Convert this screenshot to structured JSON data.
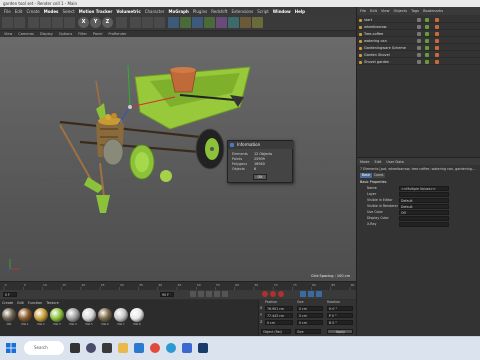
{
  "window": {
    "title": "garden tool set - Render cell 1 - Main"
  },
  "menu": {
    "items": [
      "File",
      "Edit",
      "Create",
      "Modes",
      "Select",
      "Motion Tracker",
      "Volumetric",
      "Character",
      "MoGraph",
      "Plugins",
      "Redshift",
      "Extensions",
      "Script",
      "Window",
      "Help"
    ]
  },
  "toolbar": {
    "x": "X",
    "y": "Y",
    "z": "Z"
  },
  "viewport": {
    "menu": [
      "View",
      "Cameras",
      "Display",
      "Options",
      "Filter",
      "Panel",
      "ProRender"
    ],
    "grid_spacing": "Grid Spacing : 100 cm"
  },
  "dialog": {
    "title": "Information",
    "rows": [
      {
        "label": "Elements",
        "value": "12 Objects"
      },
      {
        "label": "Points",
        "value": "25909"
      },
      {
        "label": "Polygons",
        "value": "16940"
      },
      {
        "label": "Objects",
        "value": "6"
      }
    ],
    "ok_label": "OK"
  },
  "object_manager": {
    "menu": [
      "File",
      "Edit",
      "View",
      "Objects",
      "Tags",
      "Bookmarks"
    ],
    "objects": [
      "start",
      "wheelbarrow",
      "Tree-coffee",
      "watering can",
      "Gardeningware Scheme",
      "Garden Shovel",
      "Shovel garden"
    ]
  },
  "attributes": {
    "menu": [
      "Mode",
      "Edit",
      "User Data"
    ],
    "header": "7 Elements [pot, wheelbarrow, tree coffee, watering can, gardening...",
    "tabs": [
      "Basic",
      "Coord."
    ],
    "section": "Basic Properties",
    "rows": [
      {
        "label": "Name",
        "value": "<<Multiple Values>>"
      },
      {
        "label": "Layer",
        "value": ""
      },
      {
        "label": "Visible in Editor",
        "value": "Default"
      },
      {
        "label": "Visible in Renderer",
        "value": "Default"
      },
      {
        "label": "Use Color",
        "value": "Off"
      },
      {
        "label": "Display Color",
        "value": ""
      },
      {
        "label": "X-Ray",
        "value": ""
      }
    ]
  },
  "timeline": {
    "frame_current": "0 F",
    "frame_end": "90 F",
    "ticks": [
      "0",
      "5",
      "10",
      "15",
      "20",
      "25",
      "30",
      "35",
      "40",
      "45",
      "50",
      "55",
      "60",
      "65",
      "70",
      "75",
      "80",
      "85",
      "90"
    ]
  },
  "materials": {
    "menu": [
      "Create",
      "Edit",
      "Function",
      "Texture"
    ],
    "items": [
      "Mat",
      "Mat.1",
      "Mat.2",
      "Mat.3",
      "Mat.4",
      "Mat.5",
      "Mat.6",
      "Mat.7",
      "Mat.8"
    ],
    "colors": [
      "#6d6250",
      "#8a5a2a",
      "#c9a23b",
      "#8cc23a",
      "#a0a0a0",
      "#d8d8d8",
      "#7a6a4a",
      "#c8c8c8",
      "#e8e8e8"
    ]
  },
  "coordinates": {
    "headers": [
      "Position",
      "Size",
      "Rotation"
    ],
    "rows": [
      {
        "axis": "X",
        "pos": "76.901 cm",
        "size": "0 cm",
        "rot": "H 0 °"
      },
      {
        "axis": "Y",
        "pos": "77.443 cm",
        "size": "0 cm",
        "rot": "P 0 °"
      },
      {
        "axis": "Z",
        "pos": "0 cm",
        "size": "0 cm",
        "rot": "B 0 °"
      }
    ],
    "mode": "Object (Rel)",
    "size_mode": "Size",
    "apply_label": "Apply"
  },
  "taskbar": {
    "search_placeholder": "Search"
  },
  "colors": {
    "accent": "#8cc23a",
    "pot": "#c06a3a"
  }
}
